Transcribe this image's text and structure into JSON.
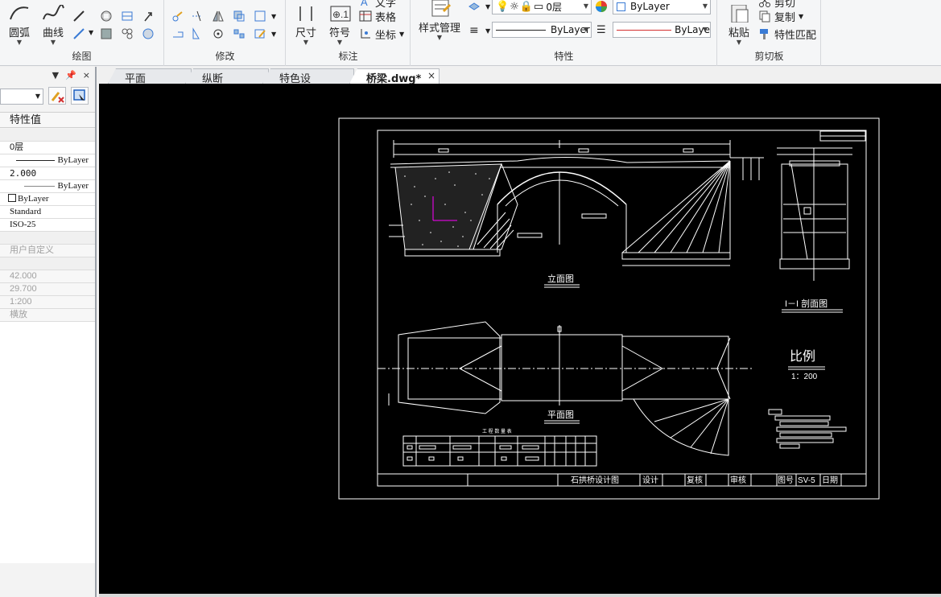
{
  "ribbon": {
    "draw_panel": {
      "title": "绘图",
      "arc_label": "圆弧",
      "curve_label": "曲线"
    },
    "modify_panel": {
      "title": "修改"
    },
    "annotate_panel": {
      "title": "标注",
      "dimension_label": "尺寸",
      "symbol_label": "符号",
      "text_label": "文字",
      "table_label": "表格",
      "coord_label": "坐标"
    },
    "properties_panel": {
      "title": "特性",
      "style_manager_label": "样式管理",
      "layer_value": "0层",
      "color_value": "ByLayer",
      "linetype_value": "ByLayer",
      "lineweight_value": "ByLaye"
    },
    "clipboard_panel": {
      "title": "剪切板",
      "paste_label": "粘贴",
      "cut_label": "剪切",
      "copy_label": "复制",
      "match_label": "特性匹配"
    }
  },
  "tabs": [
    {
      "label": "平面图.dwg"
    },
    {
      "label": "纵断面.dwg"
    },
    {
      "label": "特色设计.dwg"
    },
    {
      "label": "桥梁.dwg*",
      "active": true,
      "close": "×"
    }
  ],
  "properties": {
    "column_header": "特性值",
    "rows": [
      {
        "value": "0层"
      },
      {
        "value": "ByLayer"
      },
      {
        "value": "2.000"
      },
      {
        "value": "ByLayer"
      },
      {
        "value": "ByLayer"
      },
      {
        "value": "Standard"
      },
      {
        "value": "ISO-25"
      },
      {
        "value": "用户自定义"
      },
      {
        "value": "42.000"
      },
      {
        "value": "29.700"
      },
      {
        "value": "1:200"
      },
      {
        "value": "横放"
      }
    ],
    "pin_icon": "pin-icon",
    "close_icon": "×"
  },
  "drawing": {
    "elevation_label": "立面图",
    "section_label": "I－I 剖面图",
    "plan_label": "平面图",
    "scale_title": "比例",
    "scale_value": "1：200",
    "table_title": "工 程 数 量 表",
    "title_block": {
      "drawing_name": "石拱桥设计图",
      "design": "设计",
      "recheck": "复核",
      "audit": "审核",
      "drawing_no_label": "图号",
      "drawing_no": "SV-5",
      "date": "日期"
    }
  },
  "colors": {
    "canvas_bg": "#000000",
    "line": "#ffffff",
    "magenta": "#ff00ff",
    "ribbon_bg": "#f5f6f7",
    "panel_bg": "#f3f3f3"
  }
}
